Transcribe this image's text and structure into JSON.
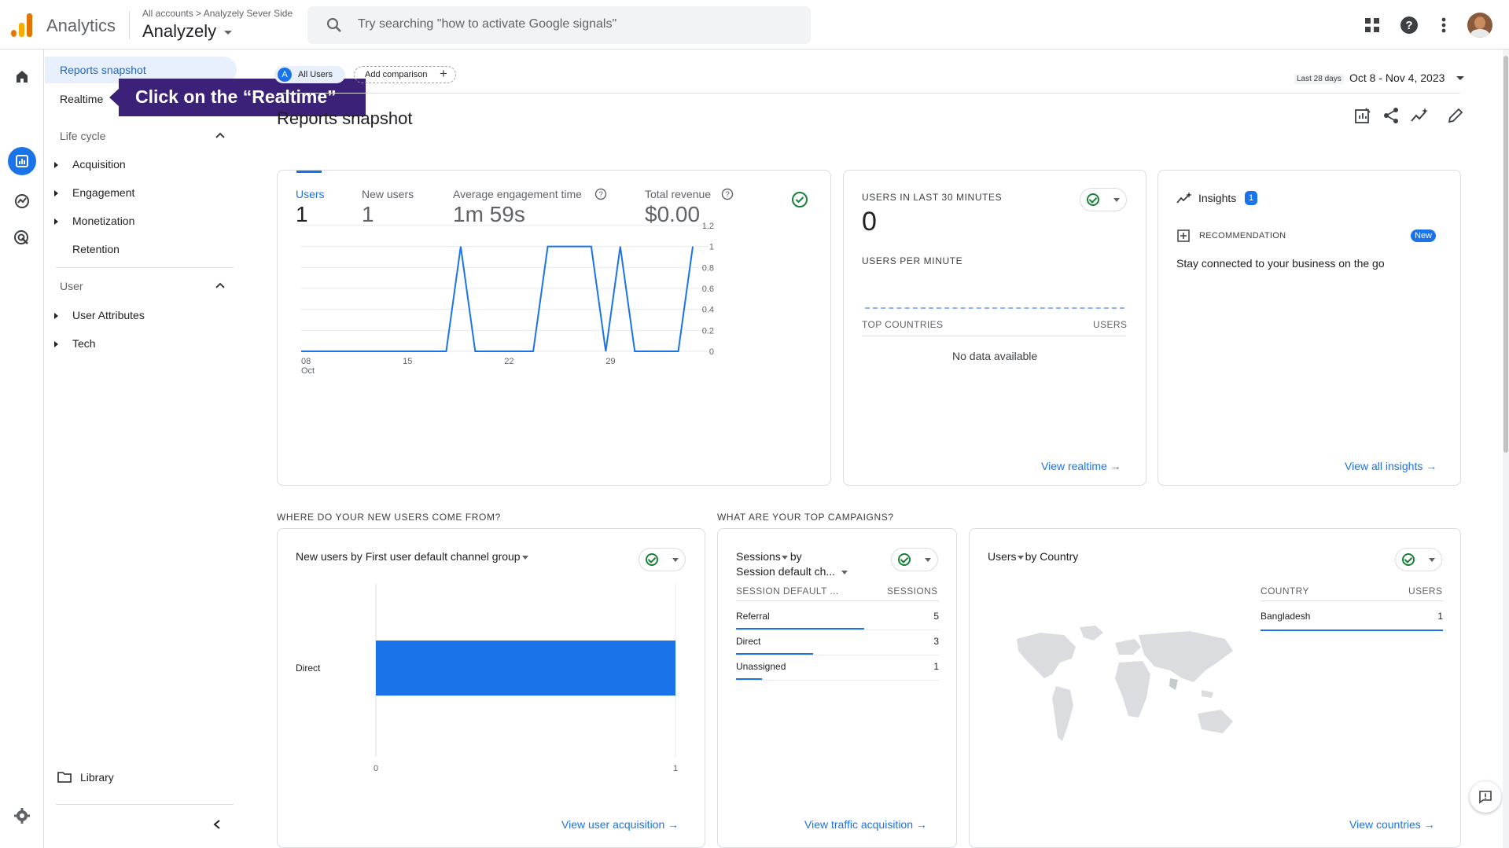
{
  "header": {
    "app_name": "Analytics",
    "breadcrumb_root": "All accounts",
    "breadcrumb_sep": ">",
    "breadcrumb_account": "Analyzely Sever Side",
    "property_name": "Analyzely",
    "search_placeholder": "Try searching \"how to activate Google signals\""
  },
  "nav": {
    "reports_snapshot": "Reports snapshot",
    "realtime": "Realtime",
    "lifecycle_heading": "Life cycle",
    "lifecycle_items": [
      "Acquisition",
      "Engagement",
      "Monetization",
      "Retention"
    ],
    "user_heading": "User",
    "user_items": [
      "User Attributes",
      "Tech"
    ],
    "library": "Library"
  },
  "callout": {
    "text": "Click on the “Realtime”"
  },
  "toolbar": {
    "segment_badge": "A",
    "segment_label": "All Users",
    "add_comparison": "Add comparison",
    "date_prefix": "Last 28 days",
    "date_range": "Oct 8 - Nov 4, 2023"
  },
  "page_title": "Reports snapshot",
  "overview": {
    "metrics": [
      {
        "label": "Users",
        "value": "1"
      },
      {
        "label": "New users",
        "value": "1"
      },
      {
        "label": "Average engagement time",
        "value": "1m 59s"
      },
      {
        "label": "Total revenue",
        "value": "$0.00"
      }
    ],
    "y_ticks": [
      "1.2",
      "1",
      "0.8",
      "0.6",
      "0.4",
      "0.2",
      "0"
    ],
    "x_ticks": [
      "08",
      "15",
      "22",
      "29"
    ],
    "x_sub": "Oct"
  },
  "chart_data": [
    {
      "type": "line",
      "x": [
        "Oct 8",
        "Oct 9",
        "Oct 10",
        "Oct 11",
        "Oct 12",
        "Oct 13",
        "Oct 14",
        "Oct 15",
        "Oct 16",
        "Oct 17",
        "Oct 18",
        "Oct 19",
        "Oct 20",
        "Oct 21",
        "Oct 22",
        "Oct 23",
        "Oct 24",
        "Oct 25",
        "Oct 26",
        "Oct 27",
        "Oct 28",
        "Oct 29",
        "Oct 30",
        "Oct 31",
        "Nov 1",
        "Nov 2",
        "Nov 3",
        "Nov 4"
      ],
      "series": [
        {
          "values": [
            0,
            0,
            0,
            0,
            0,
            0,
            0,
            0,
            0,
            0,
            0,
            1,
            0,
            0,
            0,
            0,
            0,
            1,
            1,
            1,
            1,
            0,
            1,
            0,
            0,
            0,
            0,
            1
          ]
        }
      ],
      "ylim": [
        0,
        1.2
      ],
      "xlabel": "",
      "ylabel": "",
      "title": ""
    },
    {
      "type": "bar",
      "categories": [
        "Direct"
      ],
      "values": [
        1
      ],
      "xlim": [
        0,
        1
      ],
      "title": "New users by First user default channel group"
    }
  ],
  "realtime": {
    "title": "USERS IN LAST 30 MINUTES",
    "value": "0",
    "per_minute": "USERS PER MINUTE",
    "col_country": "TOP COUNTRIES",
    "col_users": "USERS",
    "empty": "No data available",
    "link": "View realtime"
  },
  "insights": {
    "title": "Insights",
    "count": "1",
    "rec_label": "RECOMMENDATION",
    "badge": "New",
    "text": "Stay connected to your business on the go",
    "link": "View all insights"
  },
  "section_new_users": "WHERE DO YOUR NEW USERS COME FROM?",
  "section_campaigns": "WHAT ARE YOUR TOP CAMPAIGNS?",
  "acq_card": {
    "title": "New users by First user default channel group",
    "x_ticks": [
      "0",
      "1"
    ],
    "link": "View user acquisition"
  },
  "campaigns": {
    "title_metric": "Sessions",
    "title_by": "by",
    "title_dim": "Session default ch...",
    "col_dim": "SESSION DEFAULT ...",
    "col_val": "SESSIONS",
    "rows": [
      {
        "label": "Referral",
        "value": "5",
        "fraction": 0.6
      },
      {
        "label": "Direct",
        "value": "3",
        "fraction": 0.36
      },
      {
        "label": "Unassigned",
        "value": "1",
        "fraction": 0.12
      }
    ],
    "link": "View traffic acquisition"
  },
  "countries": {
    "title_metric": "Users",
    "title_by": "by Country",
    "col_country": "COUNTRY",
    "col_users": "USERS",
    "rows": [
      {
        "label": "Bangladesh",
        "value": "1"
      }
    ],
    "link": "View countries"
  },
  "colors": {
    "accent": "#1a73e8",
    "callout": "#3b2178",
    "success": "#188038"
  }
}
